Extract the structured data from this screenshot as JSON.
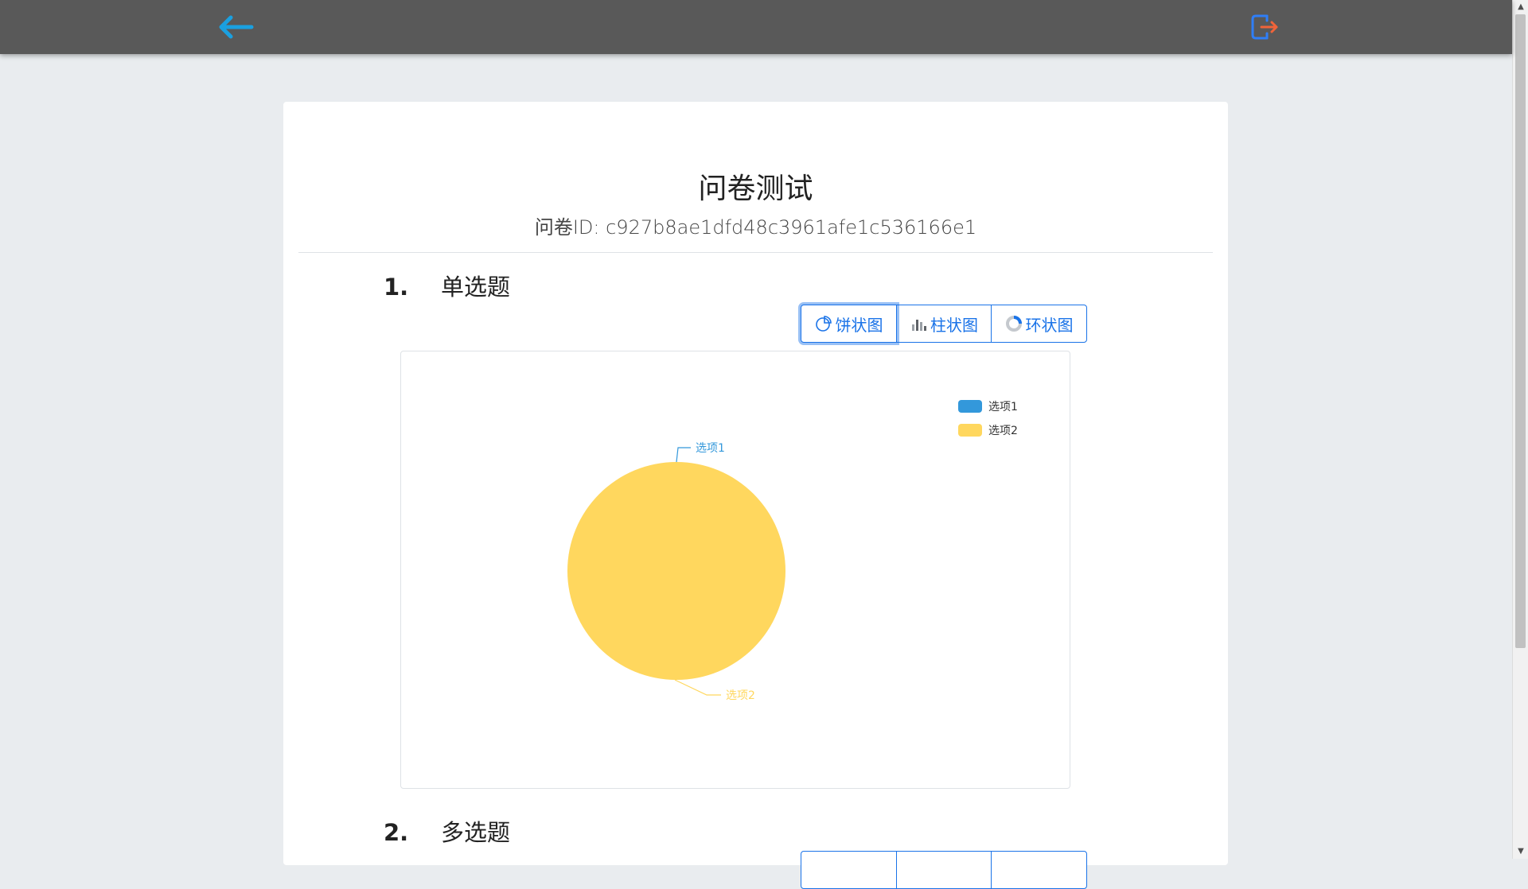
{
  "header": {
    "back_icon": "arrow-left-icon",
    "logout_icon": "logout-icon",
    "back_color": "#1aa0e0",
    "logout_color_frame": "#2f7ef7",
    "logout_color_arrow": "#f0643a"
  },
  "survey": {
    "title": "问卷测试",
    "id_line": "问卷ID: c927b8ae1dfd48c3961afe1c536166e1"
  },
  "questions": [
    {
      "number": "1.",
      "title": "单选题",
      "chart_buttons": [
        {
          "label": "饼状图",
          "icon": "pie-chart-icon",
          "active": true
        },
        {
          "label": "柱状图",
          "icon": "bar-chart-icon",
          "active": false
        },
        {
          "label": "环状图",
          "icon": "donut-chart-icon",
          "active": false
        }
      ]
    },
    {
      "number": "2.",
      "title": "多选题"
    }
  ],
  "chart_data": {
    "type": "pie",
    "legend_position": "top-right",
    "series": [
      {
        "name": "选项1",
        "value": 0,
        "color": "#3398db"
      },
      {
        "name": "选项2",
        "value": 1,
        "color": "#ffd75e"
      }
    ]
  }
}
